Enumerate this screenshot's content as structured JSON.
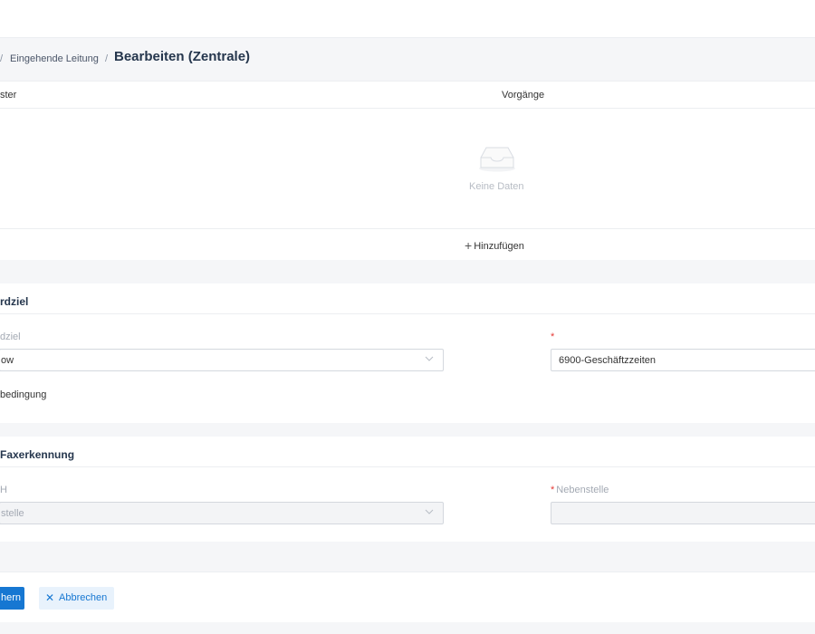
{
  "breadcrumb": {
    "separator": "/",
    "parent": "Eingehende Leitung",
    "current": "Bearbeiten (Zentrale)"
  },
  "table": {
    "columns": [
      "ster",
      "Vorgänge"
    ],
    "empty_text": "Keine Daten",
    "add_label": "Hinzufügen",
    "empty_icon": "inbox-icon"
  },
  "standard_target": {
    "title": "rdziel",
    "target_label": "dziel",
    "target_value": "ow",
    "required_mark": "*",
    "timeplan_value": "6900-Geschäftzzeiten",
    "condition_label": "bedingung"
  },
  "fax_detection": {
    "title": "Faxerkennung",
    "left_label": "H",
    "left_value": "stelle",
    "required_mark": "*",
    "extension_label": "Nebenstelle",
    "extension_value": ""
  },
  "footer": {
    "save_label": "hern",
    "cancel_label": "Abbrechen",
    "cancel_icon": "close-icon"
  },
  "colors": {
    "primary": "#1677d2",
    "title": "#25364d",
    "required": "#e53935"
  }
}
